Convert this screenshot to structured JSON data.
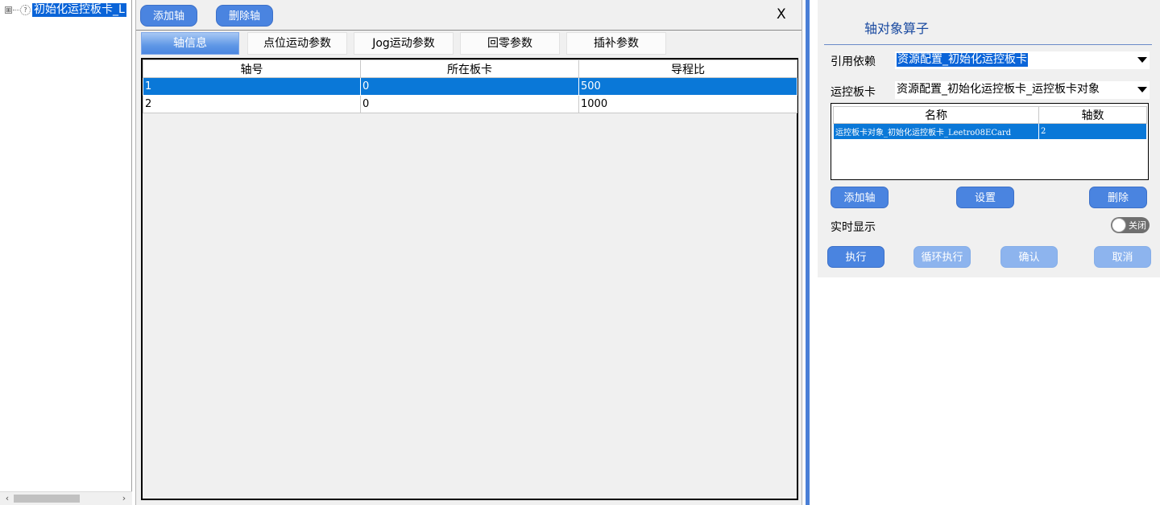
{
  "tree": {
    "expand_glyph": "⊞",
    "node_icon_glyph": "?",
    "node_label": "初始化运控板卡_L",
    "scroll_left": "‹",
    "scroll_right": "›"
  },
  "dialog": {
    "add_axis_label": "添加轴",
    "delete_axis_label": "删除轴",
    "close_label": "X",
    "tabs": [
      "轴信息",
      "点位运动参数",
      "Jog运动参数",
      "回零参数",
      "插补参数"
    ],
    "active_tab": 0,
    "table": {
      "headers": [
        "轴号",
        "所在板卡",
        "导程比"
      ],
      "rows": [
        [
          "1",
          "0",
          "500"
        ],
        [
          "2",
          "0",
          "1000"
        ]
      ],
      "selected_row": 0
    }
  },
  "props": {
    "title": "轴对象算子",
    "ref_label": "引用依赖",
    "ref_value": "资源配置_初始化运控板卡",
    "card_label": "运控板卡",
    "card_value": "资源配置_初始化运控板卡_运控板卡对象",
    "list": {
      "headers": [
        "名称",
        "轴数"
      ],
      "rows": [
        [
          "运控板卡对象_初始化运控板卡_Leetro08ECard",
          "2"
        ]
      ]
    },
    "add_axis_label": "添加轴",
    "settings_label": "设置",
    "delete_label": "删除",
    "realtime_label": "实时显示",
    "toggle_label": "关闭",
    "toggle_on": false,
    "execute_label": "执行",
    "loop_label": "循环执行",
    "confirm_label": "确认",
    "cancel_label": "取消"
  },
  "colors": {
    "accent": "#4a84e0",
    "selection": "#0a78d8",
    "separator": "#4a7fd6"
  }
}
